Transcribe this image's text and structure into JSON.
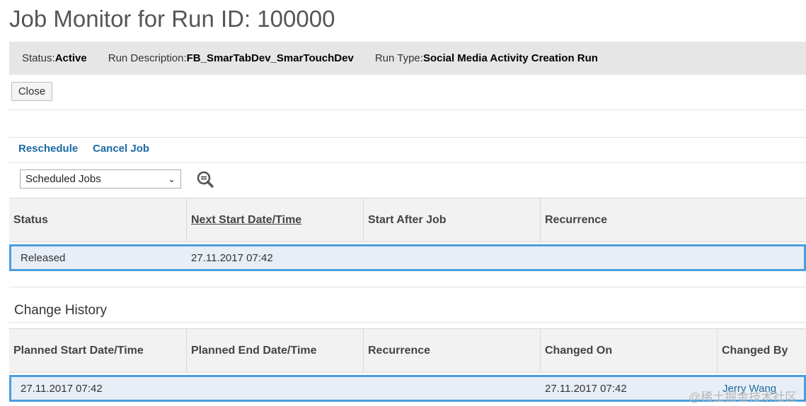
{
  "title": "Job Monitor for Run ID: 100000",
  "info": {
    "status_label": "Status:",
    "status_value": "Active",
    "description_label": "Run Description:",
    "description_value": "FB_SmarTabDev_SmarTouchDev",
    "type_label": "Run Type:",
    "type_value": "Social Media Activity Creation Run"
  },
  "close_label": "Close",
  "actions": {
    "reschedule": "Reschedule",
    "cancel": "Cancel Job"
  },
  "filter": {
    "selected": "Scheduled Jobs"
  },
  "jobs_table": {
    "columns": [
      "Status",
      "Next Start Date/Time",
      "Start After Job",
      "Recurrence"
    ],
    "rows": [
      {
        "status": "Released",
        "next_start": "27.11.2017 07:42",
        "start_after": "",
        "recurrence": ""
      }
    ]
  },
  "history": {
    "title": "Change History",
    "columns": [
      "Planned Start Date/Time",
      "Planned End Date/Time",
      "Recurrence",
      "Changed On",
      "Changed By"
    ],
    "rows": [
      {
        "planned_start": "27.11.2017 07:42",
        "planned_end": "",
        "recurrence": "",
        "changed_on": "27.11.2017 07:42",
        "changed_by": "Jerry Wang"
      }
    ]
  },
  "watermark": "@稀土掘金技术社区"
}
